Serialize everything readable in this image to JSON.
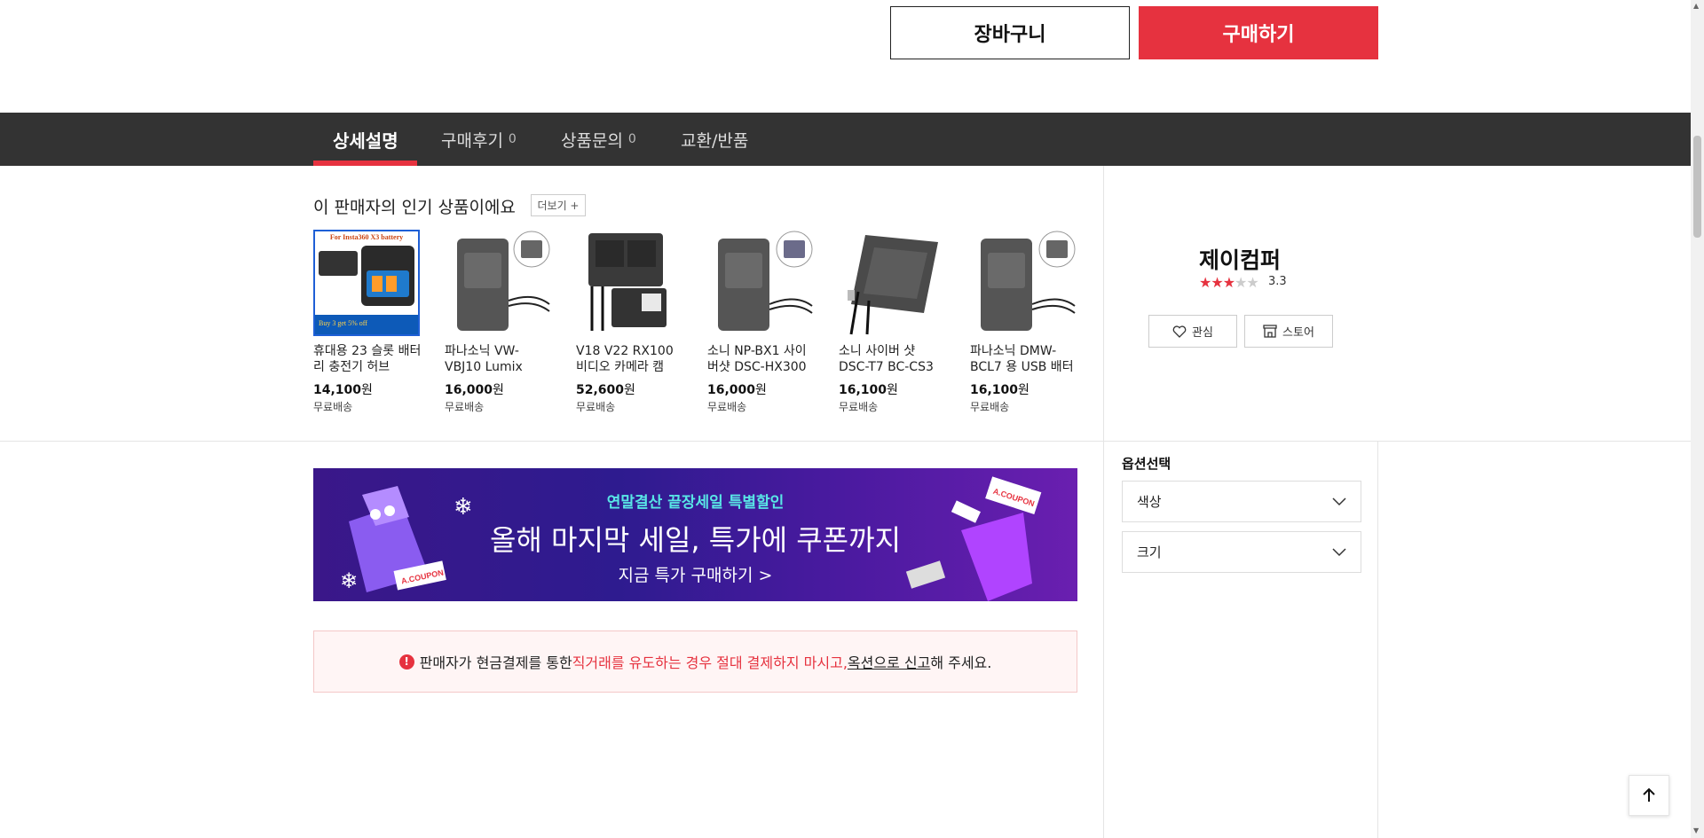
{
  "actions": {
    "cart_label": "장바구니",
    "buy_label": "구매하기"
  },
  "tabs": [
    {
      "label": "상세설명",
      "count": ""
    },
    {
      "label": "구매후기",
      "count": "0"
    },
    {
      "label": "상품문의",
      "count": "0"
    },
    {
      "label": "교환/반품",
      "count": ""
    }
  ],
  "popular": {
    "title": "이 판매자의 인기 상품이에요",
    "more_label": "더보기 +",
    "products": [
      {
        "name": "휴대용 23 슬롯 배터리 충전기 허브",
        "price": "14,100",
        "unit": "원",
        "shipping": "무료배송",
        "badge": "For Insta360 X3 battery",
        "promo": "Buy 3 get 5% off"
      },
      {
        "name": "파나소닉 VW-VBJ10 Lumix",
        "price": "16,000",
        "unit": "원",
        "shipping": "무료배송"
      },
      {
        "name": "V18 V22 RX100 비디오 카메라 캠",
        "price": "52,600",
        "unit": "원",
        "shipping": "무료배송"
      },
      {
        "name": "소니 NP-BX1 사이버샷 DSC-HX300",
        "price": "16,000",
        "unit": "원",
        "shipping": "무료배송"
      },
      {
        "name": "소니 사이버 샷 DSC-T7 BC-CS3",
        "price": "16,100",
        "unit": "원",
        "shipping": "무료배송"
      },
      {
        "name": "파나소닉 DMW-BCL7 용 USB 배터",
        "price": "16,100",
        "unit": "원",
        "shipping": "무료배송"
      }
    ]
  },
  "seller": {
    "name": "제이컴퍼",
    "rating": "3.3",
    "rating_stars": 3,
    "like_label": "관심",
    "store_label": "스토어"
  },
  "options": {
    "title": "옵션선택",
    "selects": [
      {
        "label": "색상"
      },
      {
        "label": "크기"
      }
    ]
  },
  "banner": {
    "subtitle": "연말결산 끝장세일 특별할인",
    "title": "올해 마지막 세일, 특가에 쿠폰까지",
    "cta": "지금 특가 구매하기 >",
    "coupon_text": "A.COUPON"
  },
  "warning": {
    "part1": "판매자가 현금결제를 통한 ",
    "part2": "직거래를 유도하는 경우 절대 결제하지 마시고,",
    "part3": " ",
    "part4": "옥션으로 신고",
    "part5": "해 주세요."
  },
  "colors": {
    "accent": "#e6323f",
    "tabbar": "#333333"
  }
}
